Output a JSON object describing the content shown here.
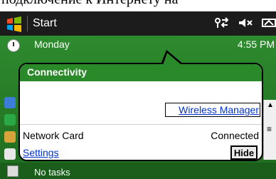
{
  "top_text": "подключение к Интернету на",
  "titlebar": {
    "start_label": "Start",
    "status_icons": [
      "connectivity-icon",
      "speaker-muted-icon",
      "battery-icon"
    ]
  },
  "today": {
    "day_label": "Monday",
    "time_label": "4:55 PM",
    "tasks_label": "No tasks"
  },
  "bubble": {
    "title": "Connectivity",
    "wireless_manager_link": "Wireless Manager",
    "network_card_label": "Network Card",
    "network_card_status": "Connected",
    "settings_link": "Settings",
    "hide_button": "Hide"
  },
  "colors": {
    "accent_green": "#2a8a2a",
    "titlebar": "#1c1c1c",
    "link_blue": "#0033cc"
  }
}
